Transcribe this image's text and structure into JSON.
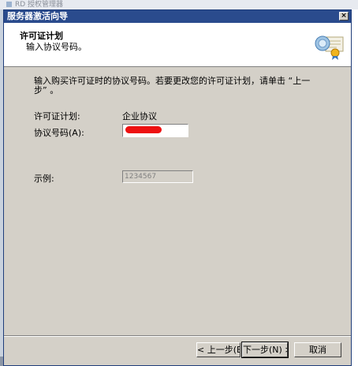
{
  "background": {
    "app_title": "RD 授权管理器"
  },
  "window": {
    "title": "服务器激活向导",
    "close_label": "×"
  },
  "header": {
    "title": "许可证计划",
    "subtitle": "输入协议号码。",
    "icon": "certificate-wizard-icon"
  },
  "content": {
    "instruction": "输入购买许可证时的协议号码。若要更改您的许可证计划，请单击 “上一步” 。",
    "license_plan_label": "许可证计划:",
    "license_plan_value": "企业协议",
    "agreement_label": "协议号码(A):",
    "example_label": "示例:",
    "example_value": "1234567"
  },
  "buttons": {
    "back": "< 上一步(B)",
    "next": "下一步(N) >",
    "cancel": "取消"
  },
  "colors": {
    "titlebar": "#2a4b8d",
    "dialog": "#d4d0c8",
    "redaction": "#ee1111"
  }
}
